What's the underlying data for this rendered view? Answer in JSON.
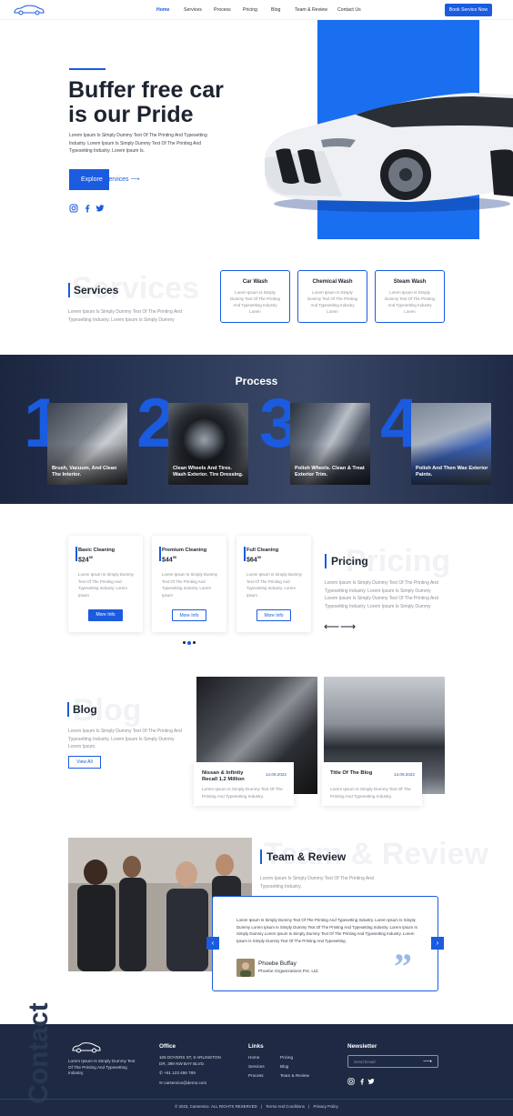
{
  "nav": {
    "links": [
      "Home",
      "Services",
      "Process",
      "Pricing",
      "Blog",
      "Team & Review",
      "Contact Us"
    ],
    "cta": "Book Service Now"
  },
  "hero": {
    "title": "Buffer free car is our Pride",
    "text": "Lorem Ipsum Is Simply Dummy Text Of The Printing And Typesetting Industry. Lorem Ipsum Is Simply Dummy Text Of The Printing And Typesetting Industry. Lorem Ipsum Is.",
    "button": "Explore Services",
    "button_lead": "Explore ",
    "button_rest": "Services",
    "button_arrow": "⟶"
  },
  "services": {
    "ghost": "Services",
    "title": "Services",
    "text": "Lorem Ipsum Is Simply Dummy Text Of The Printing And Typesetting Industry. Lorem Ipsum Is Simply Dummy",
    "cards": [
      {
        "title": "Car Wash",
        "text": "Lorem Ipsum Is Simply Dummy Text Of The Printing And Typesetting Industry Lorem"
      },
      {
        "title": "Chemical Wash",
        "text": "Lorem Ipsum Is Simply Dummy Text Of The Printing And Typesetting Industry Lorem"
      },
      {
        "title": "Steam Wash",
        "text": "Lorem Ipsum Is Simply Dummy Text Of The Printing And Typesetting Industry Lorem"
      }
    ]
  },
  "process": {
    "title": "Process",
    "steps": [
      {
        "number": "1",
        "label": "Brush, Vacuum, And Clean The Interior."
      },
      {
        "number": "2",
        "label": "Clean Wheels And Tires. Wash Exterior. Tire Dressing."
      },
      {
        "number": "3",
        "label": "Polish Wheels. Clean & Treat Exterior Trim."
      },
      {
        "number": "4",
        "label": "Polish And Then Wax Exterior Paints."
      }
    ]
  },
  "pricing": {
    "ghost": "Pricing",
    "title": "Pricing",
    "text": "Lorem Ipsum Is Simply Dummy Text Of The Printing And Typesetting Industry. Lorem Ipsum Is Simply Dummy Lorem Ipsum Is Simply Dummy Text Of The Printing And Typesetting Industry. Lorem Ipsum Is Simply Dummy",
    "plans": [
      {
        "name": "Basic Cleaning",
        "price": "$24",
        "cents": "00",
        "text": "Lorem Ipsum Is Simply Dummy Text Of The Printing And Typesetting Industry. Lorem Ipsum",
        "button": "More Info"
      },
      {
        "name": "Premium Cleaning",
        "price": "$44",
        "cents": "00",
        "text": "Lorem Ipsum Is Simply Dummy Text Of The Printing And Typesetting Industry. Lorem Ipsum",
        "button": "More Info"
      },
      {
        "name": "Full Cleaning",
        "price": "$64",
        "cents": "00",
        "text": "Lorem Ipsum Is Simply Dummy Text Of The Printing And Typesetting Industry. Lorem Ipsum",
        "button": "More Info"
      }
    ],
    "prev": "⟵",
    "next": "⟶",
    "active_slide": 2,
    "slide_count": 3
  },
  "blog": {
    "ghost": "Blog",
    "title": "Blog",
    "text": "Lorem Ipsum Is Simply Dummy Text Of The Printing And Typesetting Industry. Lorem Ipsum Is Simply Dummy Lorem Ipsum.",
    "button": "View All",
    "posts": [
      {
        "title": "Nissan & Infinity Recall 1.2 Million",
        "date": "14.09.2022",
        "text": "Lorem Ipsum Is Simply Dummy Text Of The Printing And Typesetting Industry."
      },
      {
        "title": "Title Of The Blog",
        "date": "14.09.2022",
        "text": "Lorem Ipsum Is Simply Dummy Text Of The Printing And Typesetting Industry."
      }
    ]
  },
  "team": {
    "ghost": "Team & Review",
    "title": "Team & Review",
    "text": "Lorem Ipsum Is Simply Dummy Text Of The Printing And Typesetting Industry.",
    "review": {
      "text": "Lorem Ipsum Is Simply Dummy Text Of The Printing And Typesetting Industry. Lorem Ipsum Is Simply Dummy Lorem Ipsum Is Simply Dummy Text Of The Printing And Typesetting Industry. Lorem Ipsum Is Simply Dummy Lorem Ipsum Is Simply Dummy Text Of The Printing And Typesetting Industry. Lorem Ipsum Is Simply Dummy Text Of The Printing And Typesetting.",
      "name": "Phoebe Buffay",
      "org": "Phoebe Organizations Pvt. Ltd.",
      "quote": "”"
    },
    "prev": "‹",
    "next": "›"
  },
  "footer": {
    "ghost": "Contact",
    "about": "Lorem Ipsum Is Simply Dummy Text Of The Printing And Typesetting Industry.",
    "office_heading": "Office",
    "address": "106 DOYERS ST, 8 ARLINGTON DR, 399 NW BAY BLVD.",
    "phone": "+61 123 456 789",
    "email": "carservice@demo.com",
    "links_heading": "Links",
    "links_col1": [
      "Home",
      "Services",
      "Process"
    ],
    "links_col2": [
      "Pricing",
      "Blog",
      "Team & Review"
    ],
    "newsletter_heading": "Newsletter",
    "email_placeholder": "Send Email",
    "copyright": "© 2023, Carservice. ALL RIGHTS RESERVED",
    "terms": "Terms And Conditions",
    "privacy": "Privacy Policy",
    "sep": "|"
  },
  "colors": {
    "accent": "#1a5be0",
    "dark": "#1e2a44",
    "text": "#1d2330",
    "muted": "#8a8f9a"
  },
  "icons": [
    "car-logo-icon",
    "instagram-icon",
    "facebook-icon",
    "twitter-icon",
    "arrow-right-icon",
    "arrow-left-icon",
    "quote-icon",
    "location-icon",
    "phone-icon",
    "mail-icon",
    "send-icon"
  ]
}
